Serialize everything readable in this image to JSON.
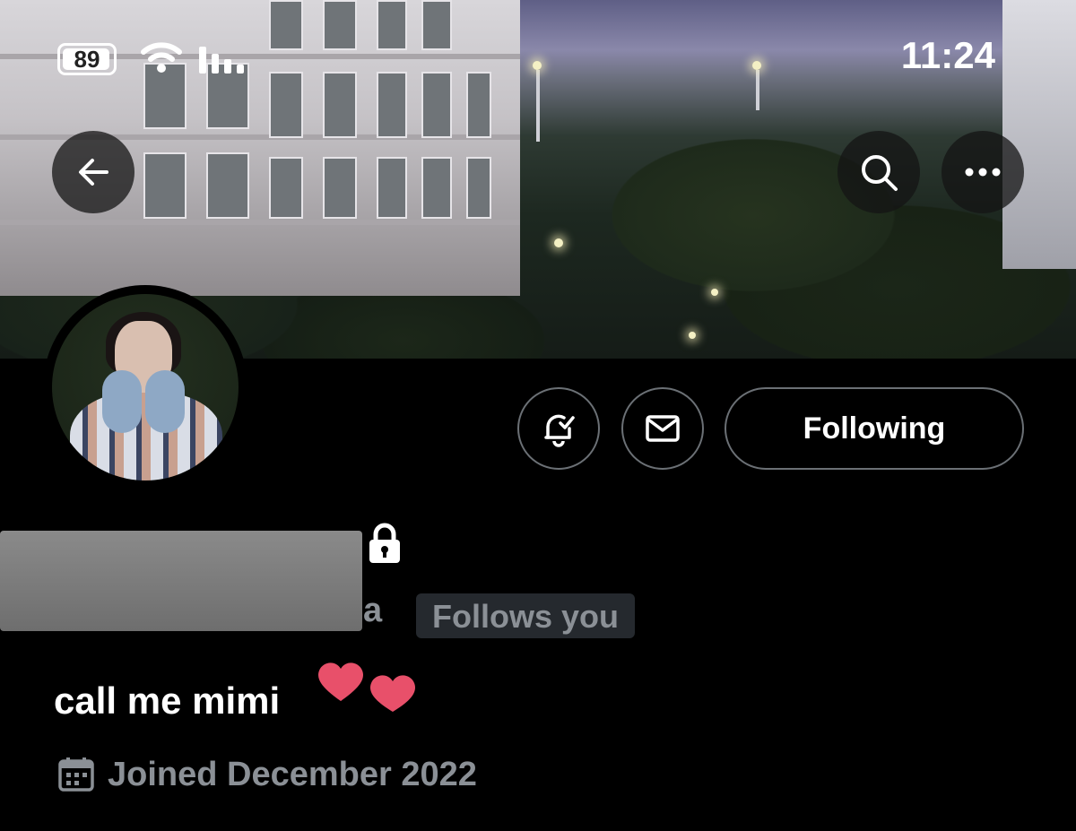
{
  "status_bar": {
    "battery": "89",
    "time": "11:24"
  },
  "profile_actions": {
    "following_label": "Following"
  },
  "profile": {
    "handle_tail": "a",
    "follows_you": "Follows you",
    "bio": "call me mimi",
    "joined": "Joined December 2022"
  },
  "icons": {
    "back": "arrow-left-icon",
    "search": "search-icon",
    "more": "more-horizontal-icon",
    "notify": "bell-check-icon",
    "message": "envelope-icon",
    "lock": "lock-icon",
    "calendar": "calendar-icon",
    "hearts": "hearts-emoji"
  }
}
